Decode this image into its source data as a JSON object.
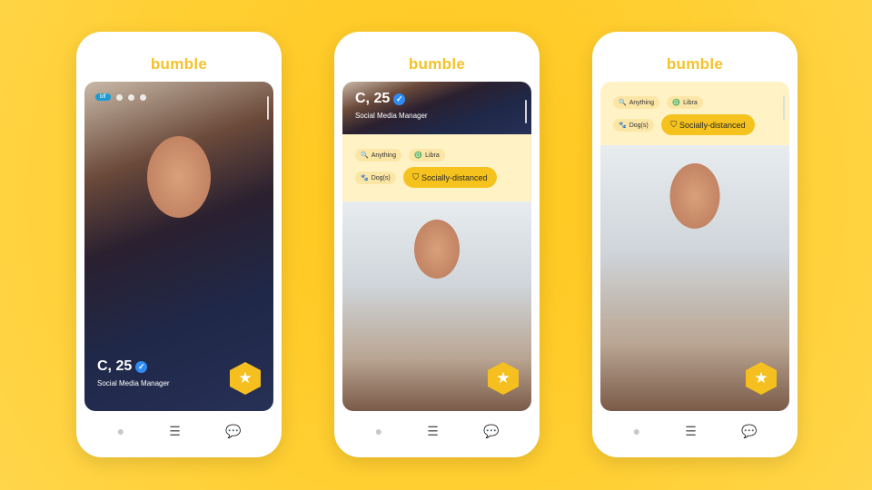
{
  "brand": {
    "logo": "bumble",
    "accent": "#f5c22b"
  },
  "profile": {
    "name_age": "C, 25",
    "job": "Social Media Manager",
    "verified": true
  },
  "mode_badge": "bff",
  "chips": [
    {
      "icon": "search-icon",
      "label": "Anything"
    },
    {
      "icon": "zodiac-icon",
      "label": "Libra"
    },
    {
      "icon": "pet-icon",
      "label": "Dog(s)"
    }
  ],
  "highlight_chip": {
    "icon": "shield-icon",
    "label": "Socially-distanced"
  },
  "nav": [
    "profile-icon",
    "stack-icon",
    "chat-icon"
  ]
}
